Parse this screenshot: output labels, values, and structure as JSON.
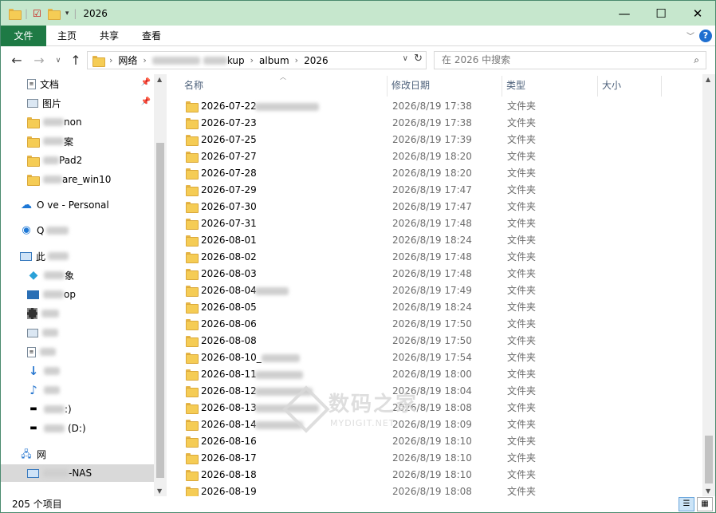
{
  "window": {
    "title": "2026",
    "controls": {
      "minimize": "—",
      "maximize": "☐",
      "close": "✕"
    }
  },
  "ribbon": {
    "tabs": [
      "文件",
      "主页",
      "共享",
      "查看"
    ],
    "help": "?"
  },
  "address": {
    "segments": [
      "网络",
      "kup",
      "album",
      "2026"
    ],
    "search_placeholder": "在 2026 中搜索"
  },
  "nav_pane": {
    "items": [
      {
        "label": "文档",
        "icon": "documents-icon",
        "pinned": true
      },
      {
        "label": "图片",
        "icon": "pictures-icon",
        "pinned": true
      },
      {
        "label": "non",
        "icon": "folder-icon"
      },
      {
        "label": "案",
        "icon": "folder-icon"
      },
      {
        "label": "Pad2",
        "icon": "folder-icon"
      },
      {
        "label": "are_win10",
        "icon": "folder-icon"
      },
      {
        "label": "O ve - Personal",
        "icon": "onedrive-icon"
      },
      {
        "label": "Q",
        "icon": "qq-icon"
      },
      {
        "label": "此",
        "icon": "this-pc-icon"
      },
      {
        "label": "象",
        "icon": "3d-objects-icon"
      },
      {
        "label": "op",
        "icon": "desktop-icon"
      },
      {
        "label": "",
        "icon": "videos-icon"
      },
      {
        "label": "",
        "icon": "pictures-icon"
      },
      {
        "label": "",
        "icon": "documents-icon"
      },
      {
        "label": "",
        "icon": "downloads-icon"
      },
      {
        "label": "",
        "icon": "music-icon"
      },
      {
        "label": ":)",
        "icon": "drive-c-icon"
      },
      {
        "label": "(D:)",
        "icon": "drive-d-icon"
      },
      {
        "label": "网",
        "icon": "network-icon"
      },
      {
        "label": "-NAS",
        "icon": "nas-computer-icon",
        "selected": true
      }
    ]
  },
  "columns": {
    "name": "名称",
    "modified": "修改日期",
    "type": "类型",
    "size": "大小"
  },
  "files": [
    {
      "name": "2026-07-22",
      "date": "2026/8/19 17:38",
      "type": "文件夹"
    },
    {
      "name": "2026-07-23",
      "date": "2026/8/19 17:38",
      "type": "文件夹"
    },
    {
      "name": "2026-07-25",
      "date": "2026/8/19 17:39",
      "type": "文件夹"
    },
    {
      "name": "2026-07-27",
      "date": "2026/8/19 18:20",
      "type": "文件夹"
    },
    {
      "name": "2026-07-28",
      "date": "2026/8/19 18:20",
      "type": "文件夹"
    },
    {
      "name": "2026-07-29",
      "date": "2026/8/19 17:47",
      "type": "文件夹"
    },
    {
      "name": "2026-07-30",
      "date": "2026/8/19 17:47",
      "type": "文件夹"
    },
    {
      "name": "2026-07-31",
      "date": "2026/8/19 17:48",
      "type": "文件夹"
    },
    {
      "name": "2026-08-01",
      "date": "2026/8/19 18:24",
      "type": "文件夹"
    },
    {
      "name": "2026-08-02",
      "date": "2026/8/19 17:48",
      "type": "文件夹"
    },
    {
      "name": "2026-08-03",
      "date": "2026/8/19 17:48",
      "type": "文件夹"
    },
    {
      "name": "2026-08-04",
      "date": "2026/8/19 17:49",
      "type": "文件夹"
    },
    {
      "name": "2026-08-05",
      "date": "2026/8/19 18:24",
      "type": "文件夹"
    },
    {
      "name": "2026-08-06",
      "date": "2026/8/19 17:50",
      "type": "文件夹"
    },
    {
      "name": "2026-08-08",
      "date": "2026/8/19 17:50",
      "type": "文件夹"
    },
    {
      "name": "2026-08-10_",
      "date": "2026/8/19 17:54",
      "type": "文件夹"
    },
    {
      "name": "2026-08-11",
      "date": "2026/8/19 18:00",
      "type": "文件夹"
    },
    {
      "name": "2026-08-12",
      "date": "2026/8/19 18:04",
      "type": "文件夹"
    },
    {
      "name": "2026-08-13",
      "date": "2026/8/19 18:08",
      "type": "文件夹"
    },
    {
      "name": "2026-08-14",
      "date": "2026/8/19 18:09",
      "type": "文件夹"
    },
    {
      "name": "2026-08-16",
      "date": "2026/8/19 18:10",
      "type": "文件夹"
    },
    {
      "name": "2026-08-17",
      "date": "2026/8/19 18:10",
      "type": "文件夹"
    },
    {
      "name": "2026-08-18",
      "date": "2026/8/19 18:10",
      "type": "文件夹"
    },
    {
      "name": "2026-08-19",
      "date": "2026/8/19 18:08",
      "type": "文件夹"
    }
  ],
  "status": {
    "count": "205 个项目"
  },
  "watermark": {
    "big": "数码之家",
    "small": "MYDIGIT.NET"
  },
  "colors": {
    "titlebar": "#c6e7cd",
    "file_tab": "#1e7a45",
    "selection": "#d9d9d9",
    "folder": "#f5cc55"
  }
}
